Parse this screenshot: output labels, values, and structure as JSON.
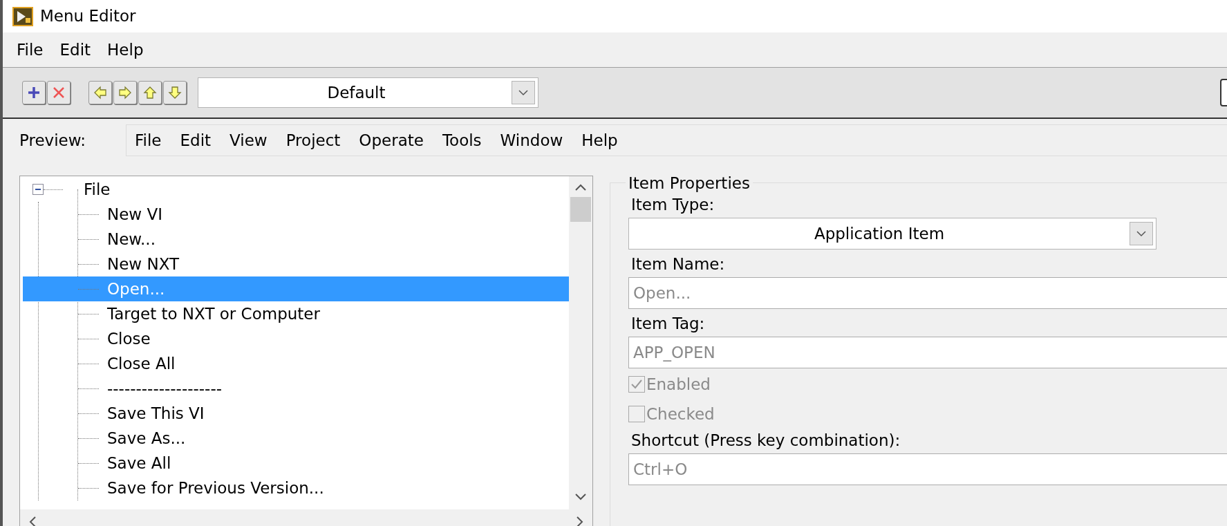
{
  "window": {
    "title": "Menu Editor"
  },
  "menu": [
    "File",
    "Edit",
    "Help"
  ],
  "toolbar": {
    "menu_type": "Default"
  },
  "preview": {
    "label": "Preview:",
    "menus": [
      "File",
      "Edit",
      "View",
      "Project",
      "Operate",
      "Tools",
      "Window",
      "Help"
    ]
  },
  "tree": [
    {
      "label": "File",
      "expanded": true,
      "selected": false,
      "children": [
        {
          "label": "New VI",
          "selected": false
        },
        {
          "label": "New...",
          "selected": false
        },
        {
          "label": "New NXT",
          "selected": false
        },
        {
          "label": "Open...",
          "selected": true
        },
        {
          "label": "Target to NXT or Computer",
          "selected": false
        },
        {
          "label": "Close",
          "selected": false
        },
        {
          "label": "Close All",
          "selected": false
        },
        {
          "label": "--------------------",
          "selected": false
        },
        {
          "label": "Save This VI",
          "selected": false
        },
        {
          "label": "Save As...",
          "selected": false
        },
        {
          "label": "Save All",
          "selected": false
        },
        {
          "label": "Save for Previous Version...",
          "selected": false
        }
      ]
    }
  ],
  "properties": {
    "title": "Item Properties",
    "item_type": {
      "label": "Item Type:",
      "value": "Application Item"
    },
    "item_name": {
      "label": "Item Name:",
      "value": "Open...",
      "disabled": true
    },
    "item_tag": {
      "label": "Item Tag:",
      "value": "APP_OPEN",
      "disabled": true
    },
    "checkboxes": [
      {
        "label": "Enabled",
        "checked": true,
        "disabled": true
      },
      {
        "label": "Checked",
        "checked": false,
        "disabled": true
      }
    ],
    "shortcut": {
      "label": "Shortcut (Press key combination):",
      "value": "Ctrl+O",
      "disabled": true
    }
  }
}
